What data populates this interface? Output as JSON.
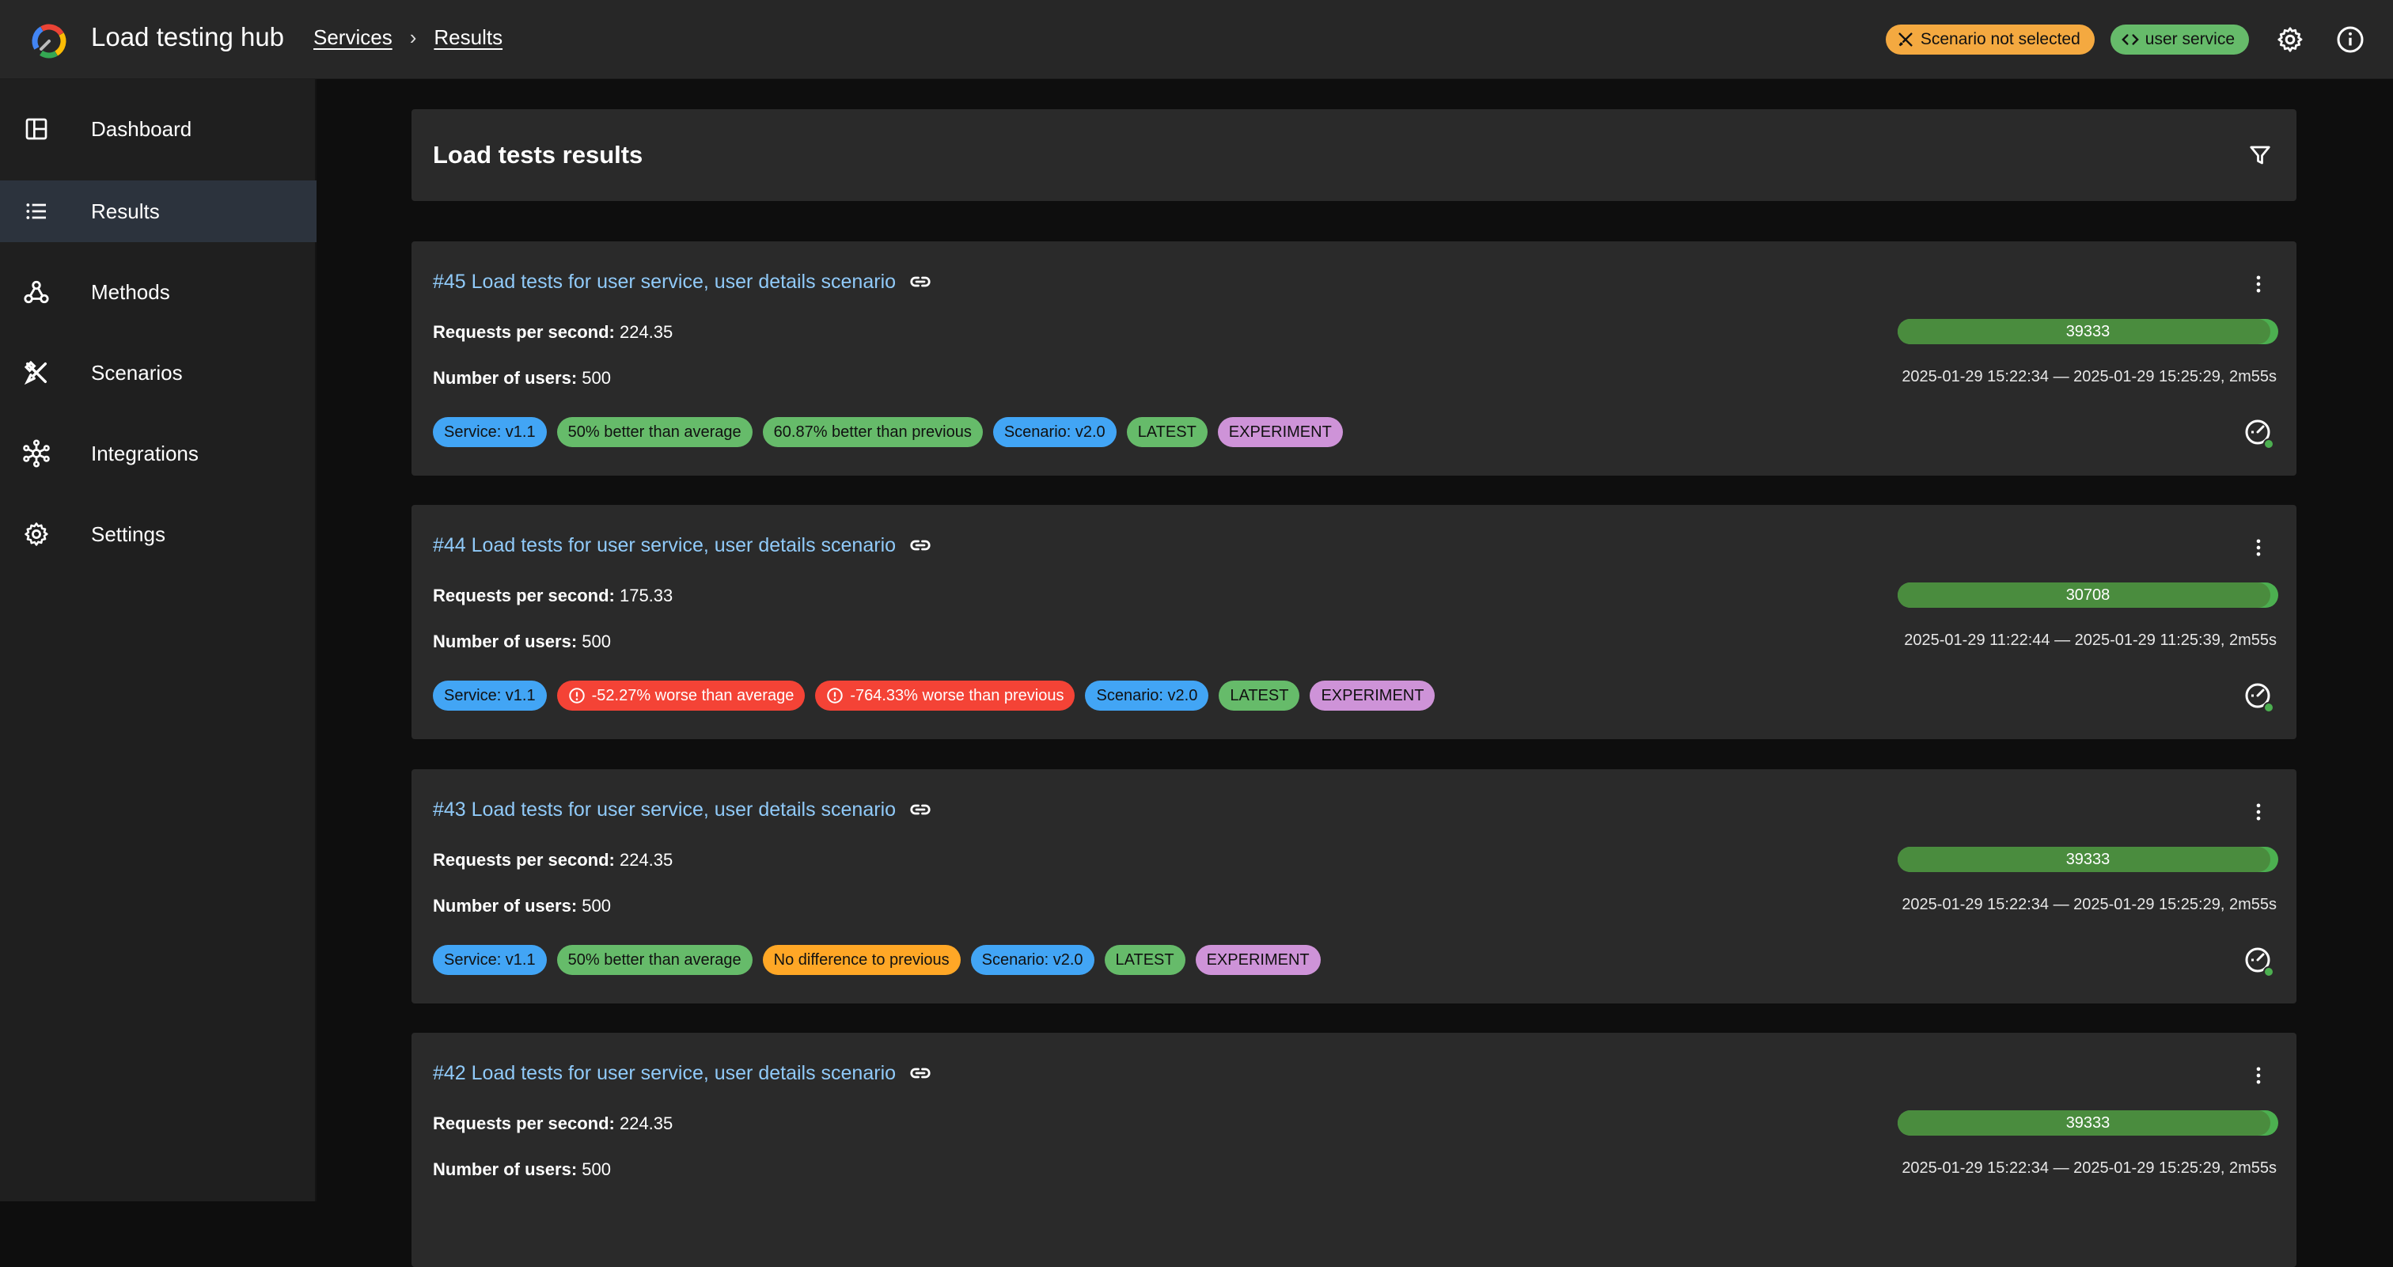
{
  "app": {
    "title": "Load testing hub",
    "breadcrumbs": [
      "Services",
      "Results"
    ],
    "scenario_chip": "Scenario not selected",
    "service_chip": "user service"
  },
  "sidebar": {
    "items": [
      {
        "label": "Dashboard",
        "icon": "dashboard-icon",
        "active": false
      },
      {
        "label": "Results",
        "icon": "list-icon",
        "active": true
      },
      {
        "label": "Methods",
        "icon": "webhook-icon",
        "active": false
      },
      {
        "label": "Scenarios",
        "icon": "tools-icon",
        "active": false
      },
      {
        "label": "Integrations",
        "icon": "hub-icon",
        "active": false
      },
      {
        "label": "Settings",
        "icon": "gear-icon",
        "active": false
      }
    ]
  },
  "panel": {
    "title": "Load tests results"
  },
  "results": [
    {
      "title": "#45 Load tests for user service, user details scenario",
      "rps_label": "Requests per second:",
      "rps": "224.35",
      "users_label": "Number of users:",
      "users": "500",
      "requests": "39333",
      "requests_fraction": 0.98,
      "time": "2025-01-29 15:22:34 — 2025-01-29 15:25:29, 2m55s",
      "tags": [
        {
          "text": "Service: v1.1",
          "color": "blue"
        },
        {
          "text": "50% better than average",
          "color": "green"
        },
        {
          "text": "60.87% better than previous",
          "color": "green"
        },
        {
          "text": "Scenario: v2.0",
          "color": "blue"
        },
        {
          "text": "LATEST",
          "color": "green"
        },
        {
          "text": "EXPERIMENT",
          "color": "purple"
        }
      ]
    },
    {
      "title": "#44 Load tests for user service, user details scenario",
      "rps_label": "Requests per second:",
      "rps": "175.33",
      "users_label": "Number of users:",
      "users": "500",
      "requests": "30708",
      "requests_fraction": 0.98,
      "time": "2025-01-29 11:22:44 — 2025-01-29 11:25:39, 2m55s",
      "tags": [
        {
          "text": "Service: v1.1",
          "color": "blue"
        },
        {
          "text": "-52.27% worse than average",
          "color": "red"
        },
        {
          "text": "-764.33% worse than previous",
          "color": "red"
        },
        {
          "text": "Scenario: v2.0",
          "color": "blue"
        },
        {
          "text": "LATEST",
          "color": "green"
        },
        {
          "text": "EXPERIMENT",
          "color": "purple"
        }
      ]
    },
    {
      "title": "#43 Load tests for user service, user details scenario",
      "rps_label": "Requests per second:",
      "rps": "224.35",
      "users_label": "Number of users:",
      "users": "500",
      "requests": "39333",
      "requests_fraction": 0.98,
      "time": "2025-01-29 15:22:34 — 2025-01-29 15:25:29, 2m55s",
      "tags": [
        {
          "text": "Service: v1.1",
          "color": "blue"
        },
        {
          "text": "50% better than average",
          "color": "green"
        },
        {
          "text": "No difference to previous",
          "color": "orange"
        },
        {
          "text": "Scenario: v2.0",
          "color": "blue"
        },
        {
          "text": "LATEST",
          "color": "green"
        },
        {
          "text": "EXPERIMENT",
          "color": "purple"
        }
      ]
    },
    {
      "title": "#42 Load tests for user service, user details scenario",
      "rps_label": "Requests per second:",
      "rps": "224.35",
      "users_label": "Number of users:",
      "users": "500",
      "requests": "39333",
      "requests_fraction": 0.98,
      "time": "2025-01-29 15:22:34 — 2025-01-29 15:25:29, 2m55s",
      "tags": []
    }
  ]
}
